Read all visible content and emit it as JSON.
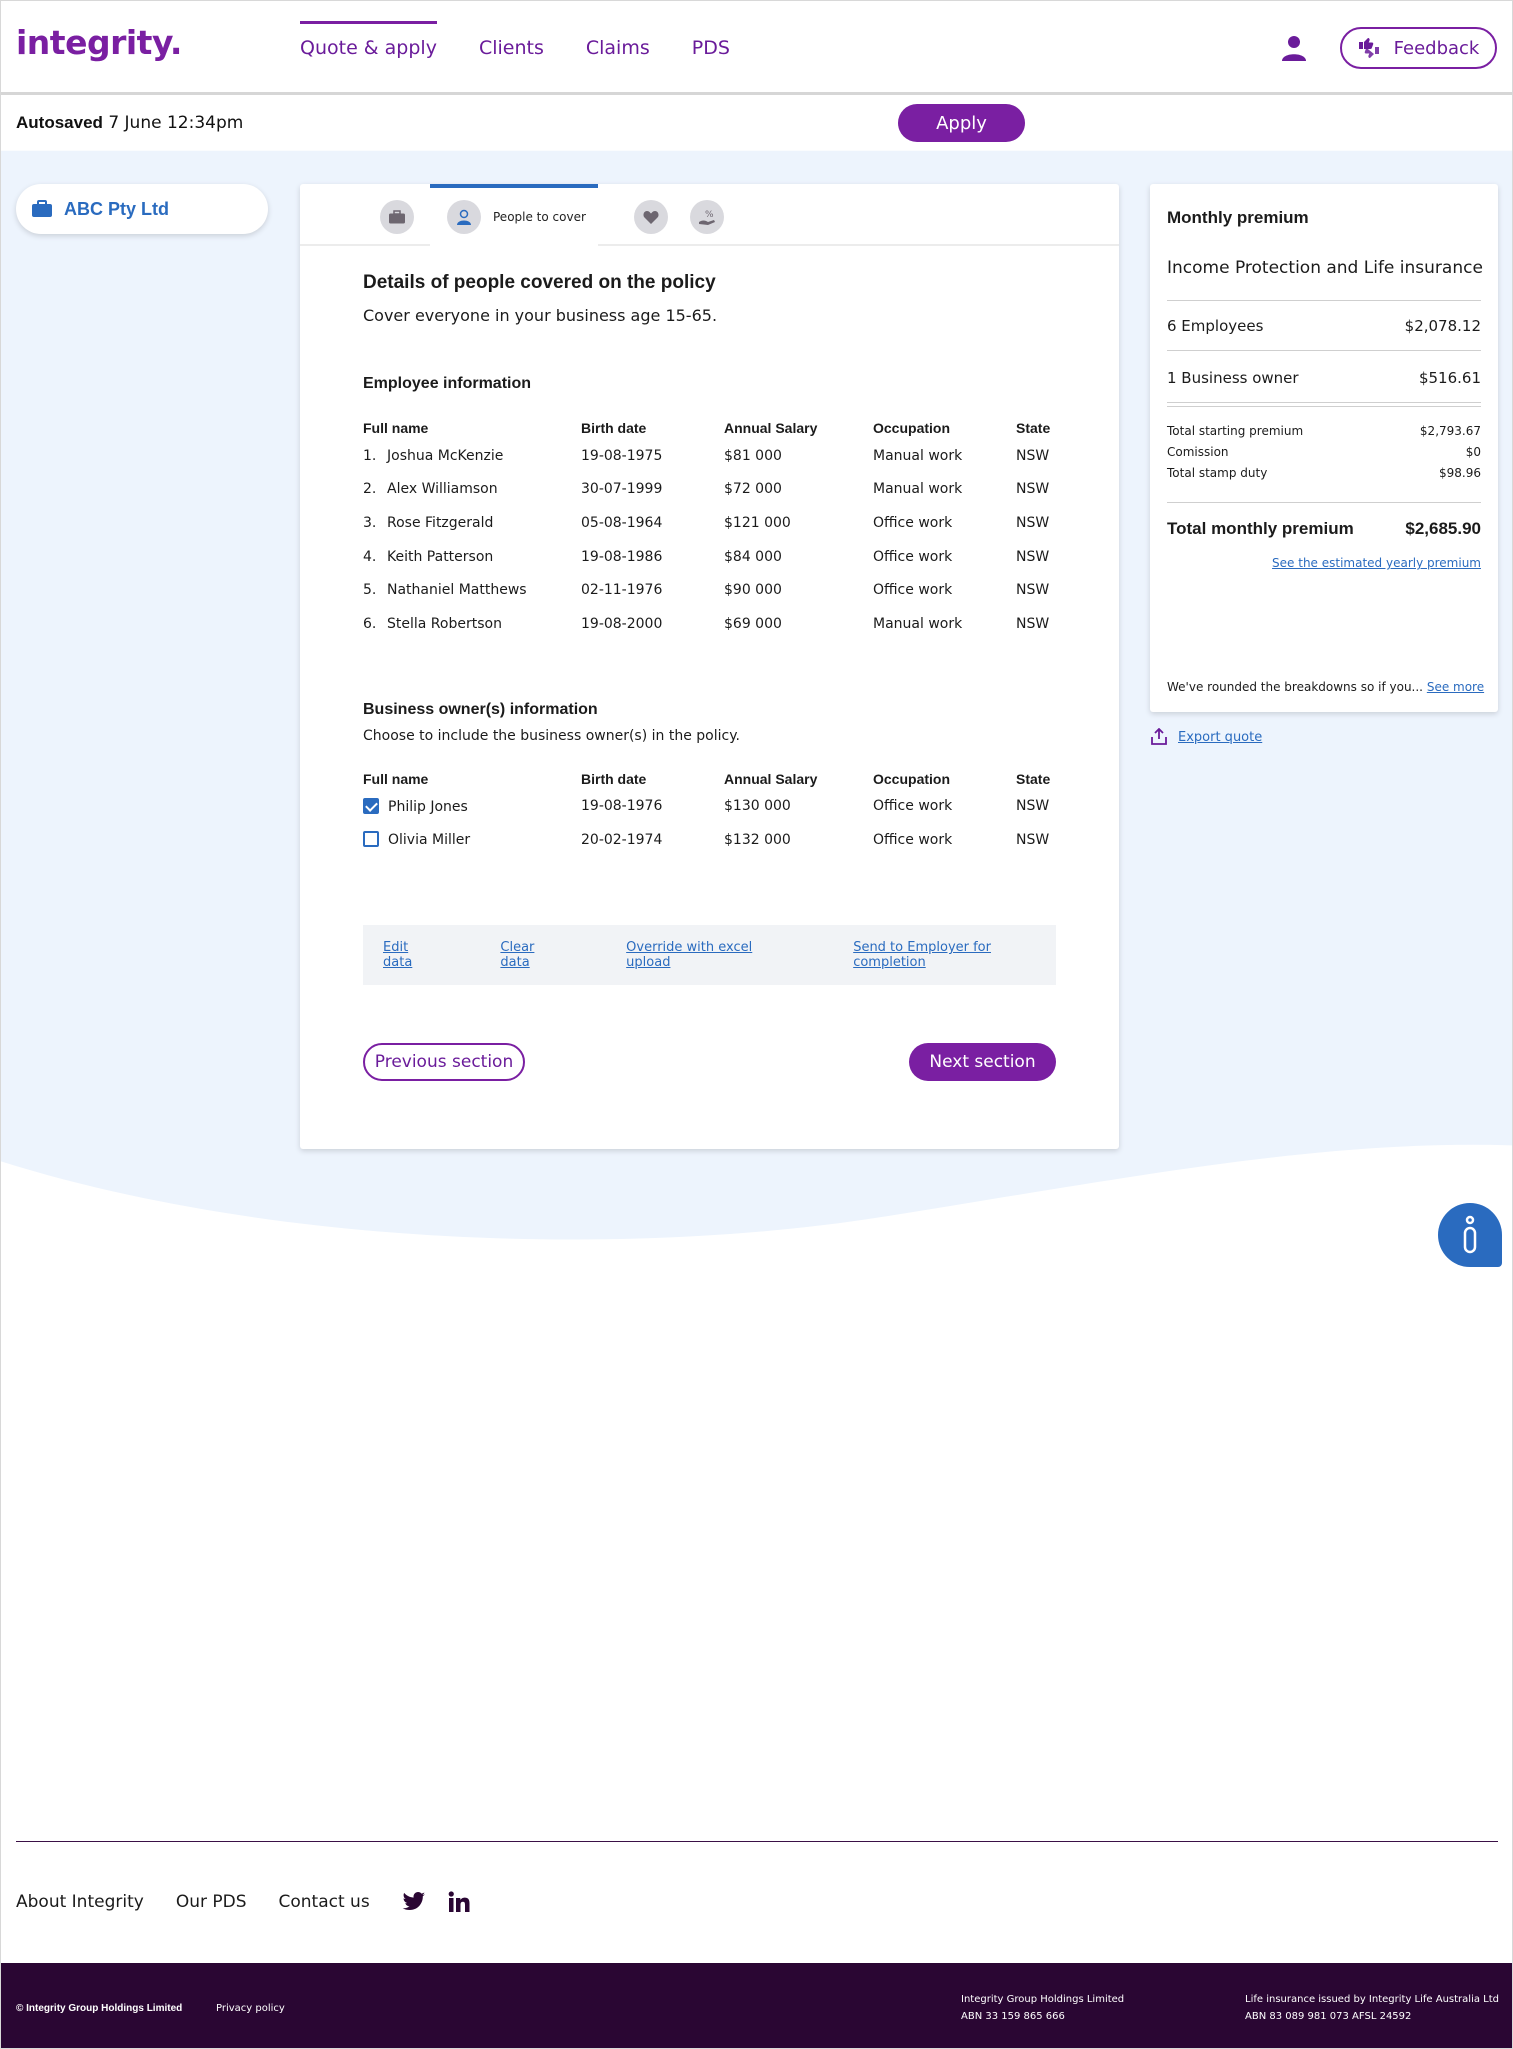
{
  "header": {
    "logo": "integrity.",
    "nav": [
      "Quote & apply",
      "Clients",
      "Claims",
      "PDS"
    ],
    "feedback_label": "Feedback"
  },
  "savebar": {
    "autosaved_label": "Autosaved",
    "autosaved_time": "7 June 12:34pm",
    "apply_label": "Apply"
  },
  "client": {
    "name": "ABC Pty Ltd"
  },
  "steps": {
    "active_label": "People to cover"
  },
  "main": {
    "title": "Details of people covered on the policy",
    "subtitle": "Cover everyone in your business age 15-65.",
    "employee_heading": "Employee information",
    "columns": [
      "Full name",
      "Birth date",
      "Annual Salary",
      "Occupation",
      "State"
    ],
    "employees": [
      {
        "num": "1.",
        "name": "Joshua McKenzie",
        "birth": "19-08-1975",
        "salary": "$81 000",
        "occupation": "Manual work",
        "state": "NSW"
      },
      {
        "num": "2.",
        "name": "Alex Williamson",
        "birth": "30-07-1999",
        "salary": "$72 000",
        "occupation": "Manual work",
        "state": "NSW"
      },
      {
        "num": "3.",
        "name": "Rose Fitzgerald",
        "birth": "05-08-1964",
        "salary": "$121 000",
        "occupation": "Office work",
        "state": "NSW"
      },
      {
        "num": "4.",
        "name": "Keith Patterson",
        "birth": "19-08-1986",
        "salary": "$84 000",
        "occupation": "Office work",
        "state": "NSW"
      },
      {
        "num": "5.",
        "name": "Nathaniel Matthews",
        "birth": "02-11-1976",
        "salary": "$90 000",
        "occupation": "Office work",
        "state": "NSW"
      },
      {
        "num": "6.",
        "name": "Stella Robertson",
        "birth": "19-08-2000",
        "salary": "$69 000",
        "occupation": "Manual work",
        "state": "NSW"
      }
    ],
    "owner_heading": "Business owner(s) information",
    "owner_subtitle": "Choose to include the business owner(s) in the policy.",
    "owners": [
      {
        "name": "Philip Jones",
        "birth": "19-08-1976",
        "salary": "$130 000",
        "occupation": "Office work",
        "state": "NSW",
        "checked": true
      },
      {
        "name": "Olivia Miller",
        "birth": "20-02-1974",
        "salary": "$132 000",
        "occupation": "Office work",
        "state": "NSW",
        "checked": false
      }
    ],
    "actions": [
      "Edit data",
      "Clear data",
      "Override with excel upload",
      "Send to Employer for completion"
    ],
    "prev_label": "Previous section",
    "next_label": "Next section"
  },
  "premium": {
    "title": "Monthly premium",
    "product": "Income Protection and Life insurance",
    "employees_label": "6 Employees",
    "employees_value": "$2,078.12",
    "owner_label": "1 Business owner",
    "owner_value": "$516.61",
    "starting_label": "Total starting premium",
    "starting_value": "$2,793.67",
    "commission_label": "Comission",
    "commission_value": "$0",
    "stamp_label": "Total stamp duty",
    "stamp_value": "$98.96",
    "total_label": "Total monthly premium",
    "total_value": "$2,685.90",
    "yearly_link": "See the estimated yearly premium",
    "rounded_note": "We've rounded the breakdowns so if you...",
    "see_more": "See more",
    "export_label": "Export quote"
  },
  "footer": {
    "links": [
      "About Integrity",
      "Our PDS",
      "Contact us"
    ],
    "copyright": "© Integrity Group Holdings Limited",
    "privacy": "Privacy policy",
    "legal1_line1": "Integrity Group Holdings Limited",
    "legal1_line2": "ABN 33 159 865 666",
    "legal2_line1": "Life insurance issued by Integrity Life Australia Ltd",
    "legal2_line2": "ABN 83 089 981 073  AFSL 24592"
  },
  "colors": {
    "brand_purple": "#7a1fa2",
    "link_blue": "#2a6bbf",
    "bg_blue": "#edf4fd",
    "footer_dark": "#2a0633"
  }
}
